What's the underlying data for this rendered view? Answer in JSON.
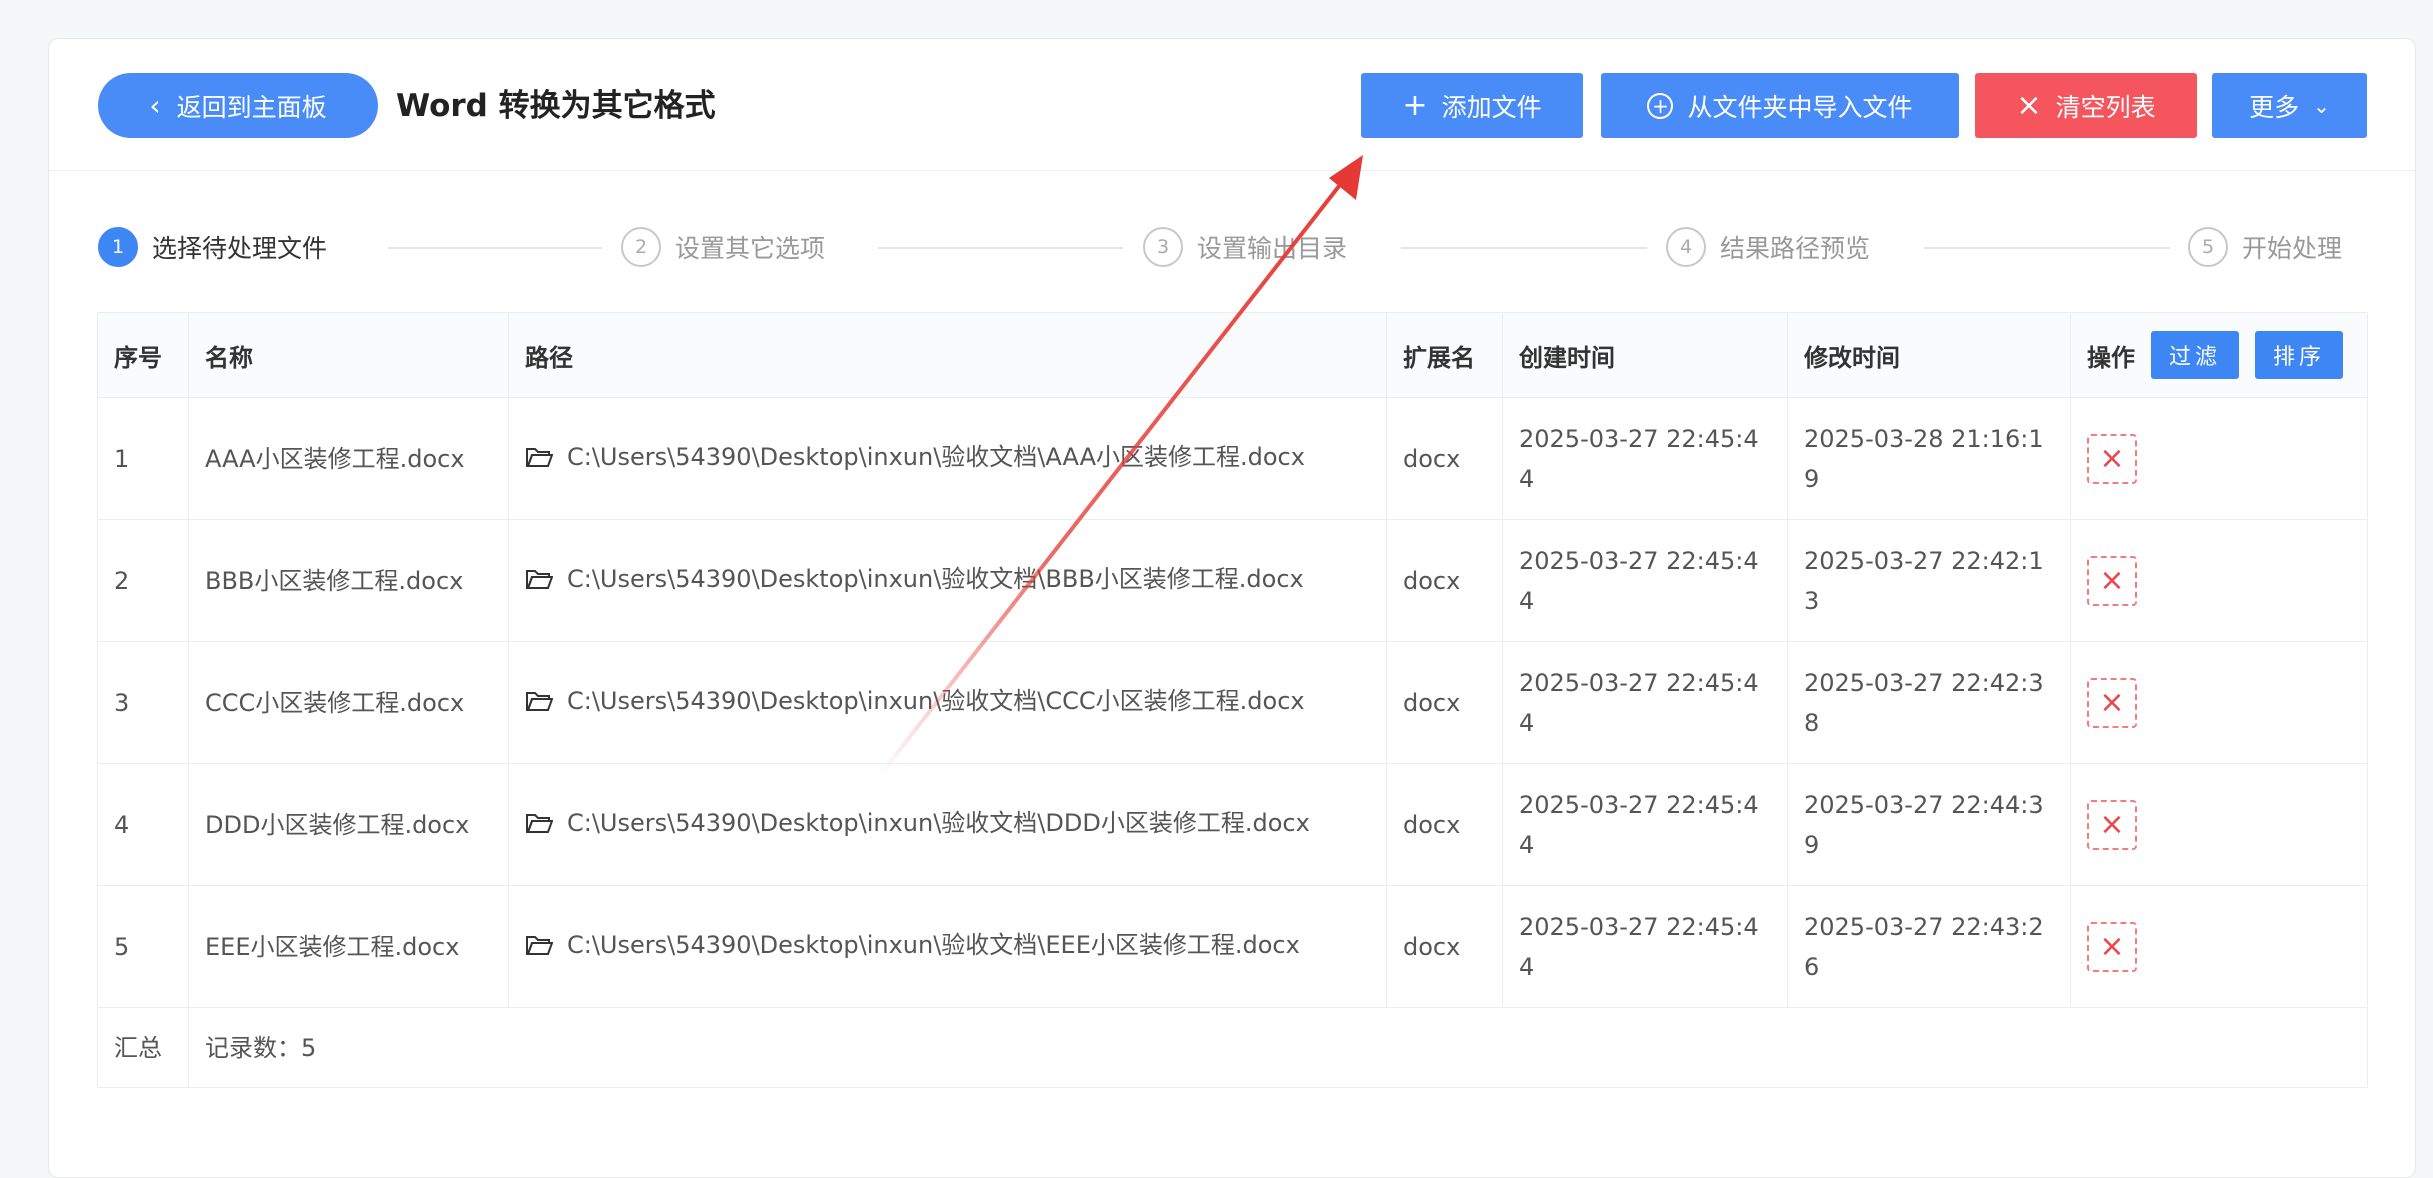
{
  "header": {
    "back_label": "返回到主面板",
    "title": "Word 转换为其它格式",
    "add_file": "添加文件",
    "import_folder": "从文件夹中导入文件",
    "clear_list": "清空列表",
    "more": "更多"
  },
  "steps": [
    {
      "num": "1",
      "label": "选择待处理文件"
    },
    {
      "num": "2",
      "label": "设置其它选项"
    },
    {
      "num": "3",
      "label": "设置输出目录"
    },
    {
      "num": "4",
      "label": "结果路径预览"
    },
    {
      "num": "5",
      "label": "开始处理"
    }
  ],
  "table": {
    "columns": {
      "index": "序号",
      "name": "名称",
      "path": "路径",
      "ext": "扩展名",
      "created": "创建时间",
      "modified": "修改时间",
      "action": "操作",
      "filter": "过滤",
      "sort": "排序"
    },
    "rows": [
      {
        "index": "1",
        "name": "AAA小区装修工程.docx",
        "path": "C:\\Users\\54390\\Desktop\\inxun\\验收文档\\AAA小区装修工程.docx",
        "ext": "docx",
        "created": "2025-03-27 22:45:44",
        "modified": "2025-03-28 21:16:19"
      },
      {
        "index": "2",
        "name": "BBB小区装修工程.docx",
        "path": "C:\\Users\\54390\\Desktop\\inxun\\验收文档\\BBB小区装修工程.docx",
        "ext": "docx",
        "created": "2025-03-27 22:45:44",
        "modified": "2025-03-27 22:42:13"
      },
      {
        "index": "3",
        "name": "CCC小区装修工程.docx",
        "path": "C:\\Users\\54390\\Desktop\\inxun\\验收文档\\CCC小区装修工程.docx",
        "ext": "docx",
        "created": "2025-03-27 22:45:44",
        "modified": "2025-03-27 22:42:38"
      },
      {
        "index": "4",
        "name": "DDD小区装修工程.docx",
        "path": "C:\\Users\\54390\\Desktop\\inxun\\验收文档\\DDD小区装修工程.docx",
        "ext": "docx",
        "created": "2025-03-27 22:45:44",
        "modified": "2025-03-27 22:44:39"
      },
      {
        "index": "5",
        "name": "EEE小区装修工程.docx",
        "path": "C:\\Users\\54390\\Desktop\\inxun\\验收文档\\EEE小区装修工程.docx",
        "ext": "docx",
        "created": "2025-03-27 22:45:44",
        "modified": "2025-03-27 22:43:26"
      }
    ],
    "summary_label": "汇总",
    "summary_count": "记录数：5"
  },
  "colors": {
    "primary": "#4a8cf7",
    "danger": "#f5565d",
    "annotation_arrow": "#e53935"
  }
}
